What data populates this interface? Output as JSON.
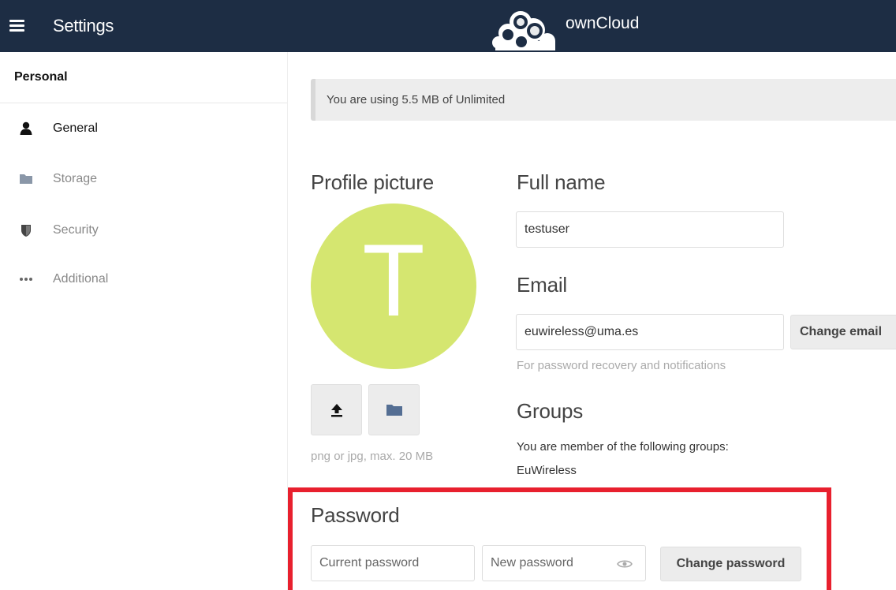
{
  "header": {
    "app_title": "Settings",
    "brand": "ownCloud",
    "bg_color": "#1d2d44"
  },
  "sidebar": {
    "heading": "Personal",
    "items": [
      {
        "label": "General",
        "icon": "user-icon",
        "active": true
      },
      {
        "label": "Storage",
        "icon": "folder-icon",
        "active": false
      },
      {
        "label": "Security",
        "icon": "shield-icon",
        "active": false
      },
      {
        "label": "Additional",
        "icon": "more-icon",
        "active": false
      }
    ]
  },
  "quota": {
    "text": "You are using 5.5 MB of Unlimited"
  },
  "profile": {
    "title": "Profile picture",
    "initial": "T",
    "avatar_color": "#d5e670",
    "hint": "png or jpg, max. 20 MB"
  },
  "fullname": {
    "title": "Full name",
    "value": "testuser"
  },
  "email": {
    "title": "Email",
    "value": "euwireless@uma.es",
    "button": "Change email",
    "hint": "For password recovery and notifications"
  },
  "groups": {
    "title": "Groups",
    "text": "You are member of the following groups:",
    "list": "EuWireless"
  },
  "password": {
    "title": "Password",
    "current_placeholder": "Current password",
    "new_placeholder": "New password",
    "button": "Change password",
    "highlight_color": "#e8202e"
  }
}
